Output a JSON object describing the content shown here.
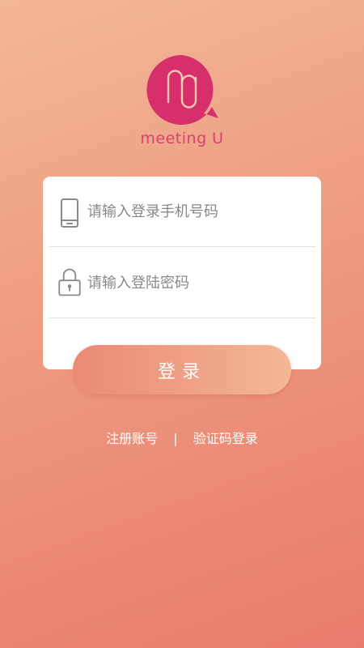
{
  "app": {
    "brand_name": "meeting U",
    "logo_icon": "mu-speech-bubble-logo",
    "brand_color": "#d62f6b"
  },
  "form": {
    "phone": {
      "icon": "phone-icon",
      "placeholder": "请输入登录手机号码",
      "value": ""
    },
    "password": {
      "icon": "lock-icon",
      "placeholder": "请输入登陆密码",
      "value": ""
    },
    "login_label": "登录"
  },
  "links": {
    "register": "注册账号",
    "separator": "|",
    "sms_login": "验证码登录"
  },
  "colors": {
    "bg_start": "#f3b898",
    "bg_end": "#e97b6d",
    "button_start": "#ea8a76",
    "button_end": "#f3b898"
  }
}
